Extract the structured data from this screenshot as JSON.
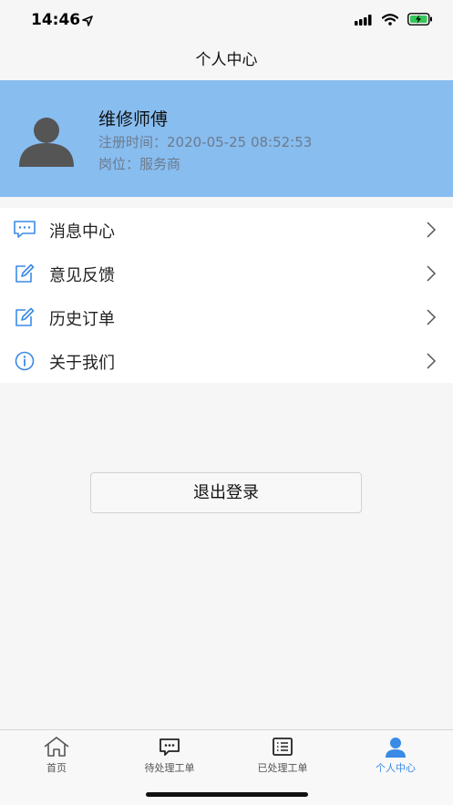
{
  "status_bar": {
    "time": "14:46"
  },
  "nav": {
    "title": "个人中心"
  },
  "profile": {
    "name": "维修师傅",
    "registration": "注册时间：2020-05-25 08:52:53",
    "role": "岗位：服务商"
  },
  "menu": {
    "items": [
      {
        "label": "消息中心",
        "icon": "message-icon"
      },
      {
        "label": "意见反馈",
        "icon": "edit-icon"
      },
      {
        "label": "历史订单",
        "icon": "edit-icon"
      },
      {
        "label": "关于我们",
        "icon": "info-icon"
      }
    ]
  },
  "logout": {
    "label": "退出登录"
  },
  "tabs": [
    {
      "label": "首页",
      "icon": "home-icon",
      "active": false
    },
    {
      "label": "待处理工单",
      "icon": "chat-icon",
      "active": false
    },
    {
      "label": "已处理工单",
      "icon": "list-icon",
      "active": false
    },
    {
      "label": "个人中心",
      "icon": "person-icon",
      "active": true
    }
  ],
  "colors": {
    "accent": "#3a8ae6",
    "profile_bg": "#88bdf0",
    "page_bg": "#f6f6f6"
  }
}
